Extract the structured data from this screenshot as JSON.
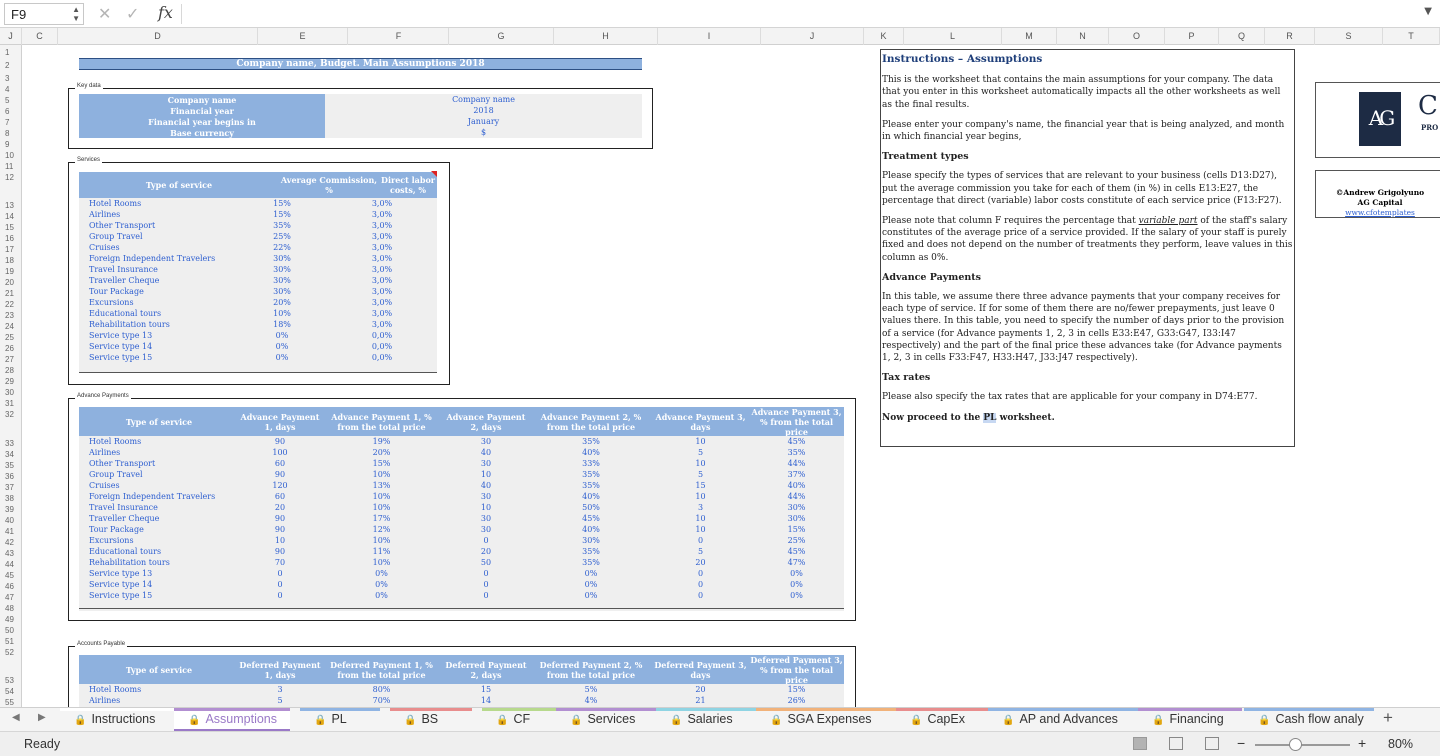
{
  "formula_bar": {
    "cell": "F9",
    "fx": "fx",
    "cancel": "✕",
    "confirm": "✓"
  },
  "columns": [
    "J",
    "C",
    "D",
    "E",
    "F",
    "G",
    "H",
    "I",
    "J",
    "K",
    "L",
    "M",
    "N",
    "O",
    "P",
    "Q",
    "R",
    "S",
    "T"
  ],
  "rows": [
    "1",
    "2",
    "3",
    "4",
    "5",
    "6",
    "7",
    "8",
    "9",
    "10",
    "11",
    "12",
    "13",
    "14",
    "15",
    "16",
    "17",
    "18",
    "19",
    "20",
    "21",
    "22",
    "23",
    "24",
    "25",
    "26",
    "27",
    "28",
    "29",
    "30",
    "31",
    "32",
    "33",
    "34",
    "35",
    "36",
    "37",
    "38",
    "39",
    "40",
    "41",
    "42",
    "43",
    "44",
    "45",
    "46",
    "47",
    "48",
    "49",
    "50",
    "51",
    "52",
    "53",
    "54",
    "55"
  ],
  "main_title": "Company name, Budget. Main Assumptions 2018",
  "key_data": {
    "label": "Key data",
    "rows": [
      {
        "k": "Company name",
        "v": "Company name"
      },
      {
        "k": "Financial year",
        "v": "2018"
      },
      {
        "k": "Financial year begins in",
        "v": "January"
      },
      {
        "k": "Base currency",
        "v": "$"
      }
    ]
  },
  "services": {
    "label": "Services",
    "headers": [
      "Type of service",
      "Average Commission, %",
      "Direct labor costs, %"
    ],
    "rows": [
      [
        "Hotel Rooms",
        "15%",
        "3,0%"
      ],
      [
        "Airlines",
        "15%",
        "3,0%"
      ],
      [
        "Other Transport",
        "35%",
        "3,0%"
      ],
      [
        "Group Travel",
        "25%",
        "3,0%"
      ],
      [
        "Cruises",
        "22%",
        "3,0%"
      ],
      [
        "Foreign Independent Travelers",
        "30%",
        "3,0%"
      ],
      [
        "Travel Insurance",
        "30%",
        "3,0%"
      ],
      [
        "Traveller Cheque",
        "30%",
        "3,0%"
      ],
      [
        "Tour Package",
        "30%",
        "3,0%"
      ],
      [
        "Excursions",
        "20%",
        "3,0%"
      ],
      [
        "Educational tours",
        "10%",
        "3,0%"
      ],
      [
        "Rehabilitation tours",
        "18%",
        "3,0%"
      ],
      [
        "Service type 13",
        "0%",
        "0,0%"
      ],
      [
        "Service type 14",
        "0%",
        "0,0%"
      ],
      [
        "Service type 15",
        "0%",
        "0,0%"
      ]
    ]
  },
  "advance": {
    "label": "Advance Payments",
    "headers": [
      "Type of service",
      "Advance Payment 1, days",
      "Advance Payment 1, % from the total price",
      "Advance Payment 2, days",
      "Advance Payment 2, % from the total price",
      "Advance Payment 3, days",
      "Advance Payment 3, % from the total price"
    ],
    "rows": [
      [
        "Hotel Rooms",
        "90",
        "19%",
        "30",
        "35%",
        "10",
        "45%"
      ],
      [
        "Airlines",
        "100",
        "20%",
        "40",
        "40%",
        "5",
        "35%"
      ],
      [
        "Other Transport",
        "60",
        "15%",
        "30",
        "33%",
        "10",
        "44%"
      ],
      [
        "Group Travel",
        "90",
        "10%",
        "10",
        "35%",
        "5",
        "37%"
      ],
      [
        "Cruises",
        "120",
        "13%",
        "40",
        "35%",
        "15",
        "40%"
      ],
      [
        "Foreign Independent Travelers",
        "60",
        "10%",
        "30",
        "40%",
        "10",
        "44%"
      ],
      [
        "Travel Insurance",
        "20",
        "10%",
        "10",
        "50%",
        "3",
        "30%"
      ],
      [
        "Traveller Cheque",
        "90",
        "17%",
        "30",
        "45%",
        "10",
        "30%"
      ],
      [
        "Tour Package",
        "90",
        "12%",
        "30",
        "40%",
        "10",
        "15%"
      ],
      [
        "Excursions",
        "10",
        "10%",
        "0",
        "30%",
        "0",
        "25%"
      ],
      [
        "Educational tours",
        "90",
        "11%",
        "20",
        "35%",
        "5",
        "45%"
      ],
      [
        "Rehabilitation tours",
        "70",
        "10%",
        "50",
        "35%",
        "20",
        "47%"
      ],
      [
        "Service type 13",
        "0",
        "0%",
        "0",
        "0%",
        "0",
        "0%"
      ],
      [
        "Service type 14",
        "0",
        "0%",
        "0",
        "0%",
        "0",
        "0%"
      ],
      [
        "Service type 15",
        "0",
        "0%",
        "0",
        "0%",
        "0",
        "0%"
      ]
    ]
  },
  "payable": {
    "label": "Accounts Payable",
    "headers": [
      "Type of service",
      "Deferred Payment 1, days",
      "Deferred Payment 1, % from the total price",
      "Deferred Payment 2, days",
      "Deferred Payment 2, % from the total price",
      "Deferred Payment 3, days",
      "Deferred Payment 3, % from the total price"
    ],
    "rows": [
      [
        "Hotel Rooms",
        "3",
        "80%",
        "15",
        "5%",
        "20",
        "15%"
      ],
      [
        "Airlines",
        "5",
        "70%",
        "14",
        "4%",
        "21",
        "26%"
      ]
    ]
  },
  "instructions": {
    "title": "Instructions – Assumptions",
    "p1": "This is the worksheet that contains the main assumptions for your company. The data that you enter in this worksheet automatically impacts all the other worksheets as well as the final results.",
    "p2": "Please enter your company's name, the financial year that is being analyzed, and month in which financial year begins,",
    "h_treat": "Treatment types",
    "p3": "Please specify the types of services that are relevant to your business (cells D13:D27), put the average commission you take for each of them (in %) in cells E13:E27, the percentage that direct (variable) labor costs constitute of each service price (F13:F27).",
    "p4a": "Please note that column F requires the percentage that ",
    "p4em": "variable part",
    "p4b": " of the staff's salary constitutes of the average price of a service provided. If the salary of your staff is purely fixed and does not depend on the number of treatments they perform, leave values in this column as 0%.",
    "h_adv": "Advance Payments",
    "p5": "In this table, we assume there three advance payments that your company receives for each type of service. If for some of them there are no/fewer prepayments, just leave 0 values there. In this table, you need to specify the number of days prior to the provision of a service (for Advance payments 1, 2, 3 in cells E33:E47, G33:G47, I33:I47 respectively) and the part of the final price these advances take (for Advance payments 1, 2, 3 in cells F33:F47, H33:H47, J33:J47 respectively).",
    "h_tax": "Tax rates",
    "p6": "Please also specify the tax rates that are applicable for your company in D74:E77.",
    "p7a": "Now proceed to the ",
    "p7b": "PL",
    "p7c": " worksheet."
  },
  "brand": {
    "logo_letters": "AG",
    "cut_letter": "C",
    "cut_sub": "PRO",
    "copyright": "©Andrew Grigolyuno",
    "company": "AG Capital",
    "url": "www.cfotemplates"
  },
  "tabs": [
    {
      "label": "Instructions",
      "color": "#ffffff"
    },
    {
      "label": "Assumptions",
      "color": "#b28fd1",
      "active": true
    },
    {
      "label": "PL",
      "color": "#8fb4e3"
    },
    {
      "label": "BS",
      "color": "#e88d8d"
    },
    {
      "label": "CF",
      "color": "#b7d98d"
    },
    {
      "label": "Services",
      "color": "#b28fd1"
    },
    {
      "label": "Salaries",
      "color": "#8fd4e3"
    },
    {
      "label": "SGA Expenses",
      "color": "#f1b27a"
    },
    {
      "label": "CapEx",
      "color": "#e88d8d"
    },
    {
      "label": "AP and Advances",
      "color": "#8fb4e3"
    },
    {
      "label": "Financing",
      "color": "#b28fd1"
    },
    {
      "label": "Cash flow analy",
      "color": "#8fb4e3"
    }
  ],
  "status": {
    "text": "Ready",
    "zoom": "80%",
    "zoom_level": 0.8
  }
}
